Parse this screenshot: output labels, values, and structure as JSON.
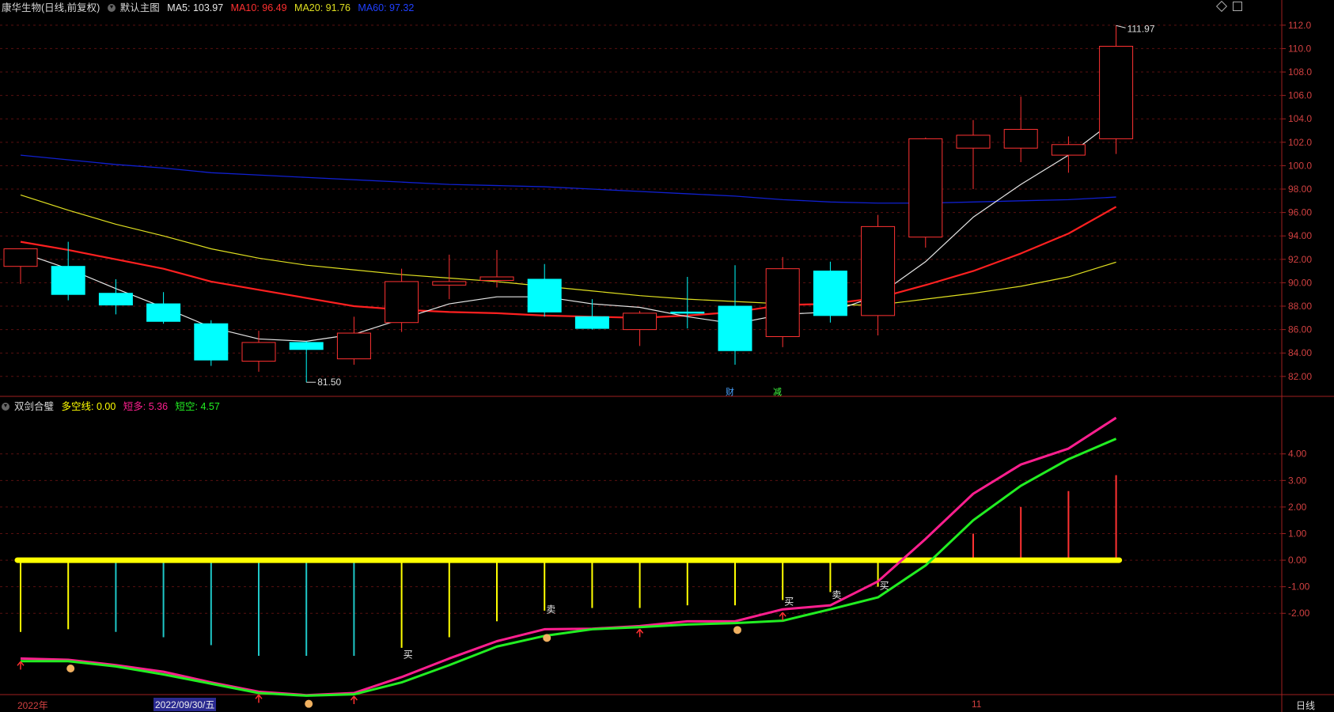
{
  "header": {
    "stock_title": "康华生物(日线,前复权)",
    "template": "默认主图",
    "ma5": "MA5: 103.97",
    "ma10": "MA10: 96.49",
    "ma20": "MA20: 91.76",
    "ma60": "MA60: 97.32"
  },
  "indicator_header": {
    "name": "双剑合璧",
    "line1": "多空线: 0.00",
    "line2": "短多: 5.36",
    "line3": "短空: 4.57"
  },
  "colors": {
    "ma5": "#e6e6e6",
    "ma10": "#ff2020",
    "ma20": "#e0e020",
    "ma60": "#1020d0",
    "up": "#ff3232",
    "down": "#00ffff",
    "pink": "#ff1f8f",
    "green": "#22ee22",
    "yellow": "#ffff00"
  },
  "price_axis_labels": [
    "112.0",
    "110.0",
    "108.0",
    "106.0",
    "104.0",
    "102.0",
    "100.0",
    "98.00",
    "96.00",
    "94.00",
    "92.00",
    "90.00",
    "88.00",
    "86.00",
    "84.00",
    "82.00"
  ],
  "indicator_axis_labels": [
    "4.00",
    "3.00",
    "2.00",
    "1.00",
    "0.00",
    "-1.00",
    "-2.00"
  ],
  "max_price_label": "111.97",
  "min_price_label": "81.50",
  "event_tags": {
    "cai": "财",
    "jian": "减"
  },
  "signal_labels": {
    "buy": "买",
    "sell": "卖"
  },
  "time_axis": {
    "left": "2022年",
    "date": "2022/09/30/五",
    "mid": "11",
    "period": "日线"
  },
  "chart_data": [
    {
      "type": "candlestick",
      "title": "康华生物(日线,前复权)",
      "ylim": [
        80.5,
        112.8
      ],
      "candles": [
        {
          "o": 91.4,
          "h": 92.6,
          "l": 89.9,
          "c": 92.9
        },
        {
          "o": 91.4,
          "h": 93.5,
          "l": 88.5,
          "c": 89.0
        },
        {
          "o": 89.1,
          "h": 90.3,
          "l": 87.3,
          "c": 88.1
        },
        {
          "o": 88.2,
          "h": 89.2,
          "l": 86.5,
          "c": 86.7
        },
        {
          "o": 86.5,
          "h": 86.8,
          "l": 82.9,
          "c": 83.4
        },
        {
          "o": 83.3,
          "h": 85.9,
          "l": 82.4,
          "c": 84.9
        },
        {
          "o": 84.9,
          "h": 85.0,
          "l": 81.5,
          "c": 84.3
        },
        {
          "o": 83.5,
          "h": 87.1,
          "l": 83.0,
          "c": 85.7
        },
        {
          "o": 86.6,
          "h": 91.2,
          "l": 85.8,
          "c": 90.1
        },
        {
          "o": 89.8,
          "h": 92.4,
          "l": 88.6,
          "c": 90.1
        },
        {
          "o": 90.2,
          "h": 92.8,
          "l": 89.6,
          "c": 90.5
        },
        {
          "o": 90.3,
          "h": 91.6,
          "l": 87.1,
          "c": 87.5
        },
        {
          "o": 87.1,
          "h": 88.6,
          "l": 86.0,
          "c": 86.1
        },
        {
          "o": 86.0,
          "h": 87.6,
          "l": 84.6,
          "c": 87.4
        },
        {
          "o": 87.5,
          "h": 90.5,
          "l": 86.1,
          "c": 87.4
        },
        {
          "o": 88.0,
          "h": 91.5,
          "l": 83.0,
          "c": 84.2
        },
        {
          "o": 85.4,
          "h": 92.2,
          "l": 84.5,
          "c": 91.2
        },
        {
          "o": 91.0,
          "h": 91.8,
          "l": 86.6,
          "c": 87.2
        },
        {
          "o": 87.2,
          "h": 95.8,
          "l": 85.5,
          "c": 94.8
        },
        {
          "o": 93.9,
          "h": 102.4,
          "l": 93.0,
          "c": 102.3
        },
        {
          "o": 101.5,
          "h": 103.9,
          "l": 98.0,
          "c": 102.6
        },
        {
          "o": 101.5,
          "h": 105.9,
          "l": 100.3,
          "c": 103.1
        },
        {
          "o": 100.9,
          "h": 102.5,
          "l": 99.4,
          "c": 101.8
        },
        {
          "o": 102.3,
          "h": 111.97,
          "l": 101.0,
          "c": 110.2
        }
      ],
      "ma5": [
        92.6,
        91.2,
        89.5,
        87.9,
        86.2,
        85.2,
        85.0,
        85.6,
        86.9,
        88.2,
        88.8,
        88.8,
        88.2,
        87.9,
        87.1,
        86.5,
        87.3,
        87.5,
        88.9,
        91.8,
        95.6,
        98.4,
        100.9,
        103.97
      ],
      "ma10": [
        93.5,
        92.8,
        92.0,
        91.2,
        90.1,
        89.4,
        88.7,
        88.0,
        87.7,
        87.5,
        87.4,
        87.2,
        87.1,
        87.0,
        87.2,
        87.5,
        88.1,
        88.2,
        88.7,
        89.8,
        91.0,
        92.5,
        94.2,
        96.49
      ],
      "ma20": [
        97.5,
        96.2,
        95.0,
        94.0,
        92.9,
        92.1,
        91.5,
        91.1,
        90.7,
        90.4,
        90.1,
        89.7,
        89.3,
        88.9,
        88.6,
        88.4,
        88.2,
        88.1,
        88.1,
        88.6,
        89.1,
        89.7,
        90.5,
        91.76
      ],
      "ma60": [
        100.9,
        100.5,
        100.1,
        99.8,
        99.4,
        99.2,
        99.0,
        98.8,
        98.6,
        98.4,
        98.3,
        98.2,
        98.0,
        97.8,
        97.6,
        97.4,
        97.1,
        96.9,
        96.8,
        96.8,
        96.9,
        97.0,
        97.1,
        97.32
      ]
    },
    {
      "type": "line",
      "title": "双剑合璧",
      "ylim": [
        -5.0,
        5.6
      ],
      "series": [
        {
          "name": "多空线",
          "values": [
            0,
            0,
            0,
            0,
            0,
            0,
            0,
            0,
            0,
            0,
            0,
            0,
            0,
            0,
            0,
            0,
            0,
            0,
            0,
            0,
            0,
            0,
            0,
            0
          ]
        },
        {
          "name": "短多",
          "values": [
            -3.7,
            -3.75,
            -3.95,
            -4.2,
            -4.6,
            -4.95,
            -5.08,
            -5.0,
            -4.4,
            -3.7,
            -3.05,
            -2.6,
            -2.58,
            -2.48,
            -2.3,
            -2.3,
            -1.85,
            -1.7,
            -0.8,
            0.8,
            2.5,
            3.6,
            4.2,
            5.36
          ]
        },
        {
          "name": "短空",
          "values": [
            -3.8,
            -3.8,
            -4.0,
            -4.3,
            -4.65,
            -5.0,
            -5.1,
            -5.05,
            -4.6,
            -3.95,
            -3.25,
            -2.85,
            -2.6,
            -2.52,
            -2.42,
            -2.37,
            -2.28,
            -1.85,
            -1.4,
            -0.2,
            1.5,
            2.8,
            3.8,
            4.57
          ]
        },
        {
          "name": "柱",
          "values": [
            -2.7,
            -2.6,
            -2.7,
            -2.9,
            -3.2,
            -3.6,
            -3.6,
            -3.6,
            -3.3,
            -2.9,
            -2.3,
            -1.9,
            -1.8,
            -1.8,
            -1.7,
            -1.7,
            -1.5,
            -1.2,
            -1.0,
            0,
            1.0,
            2.0,
            2.6,
            3.2
          ]
        }
      ]
    }
  ]
}
